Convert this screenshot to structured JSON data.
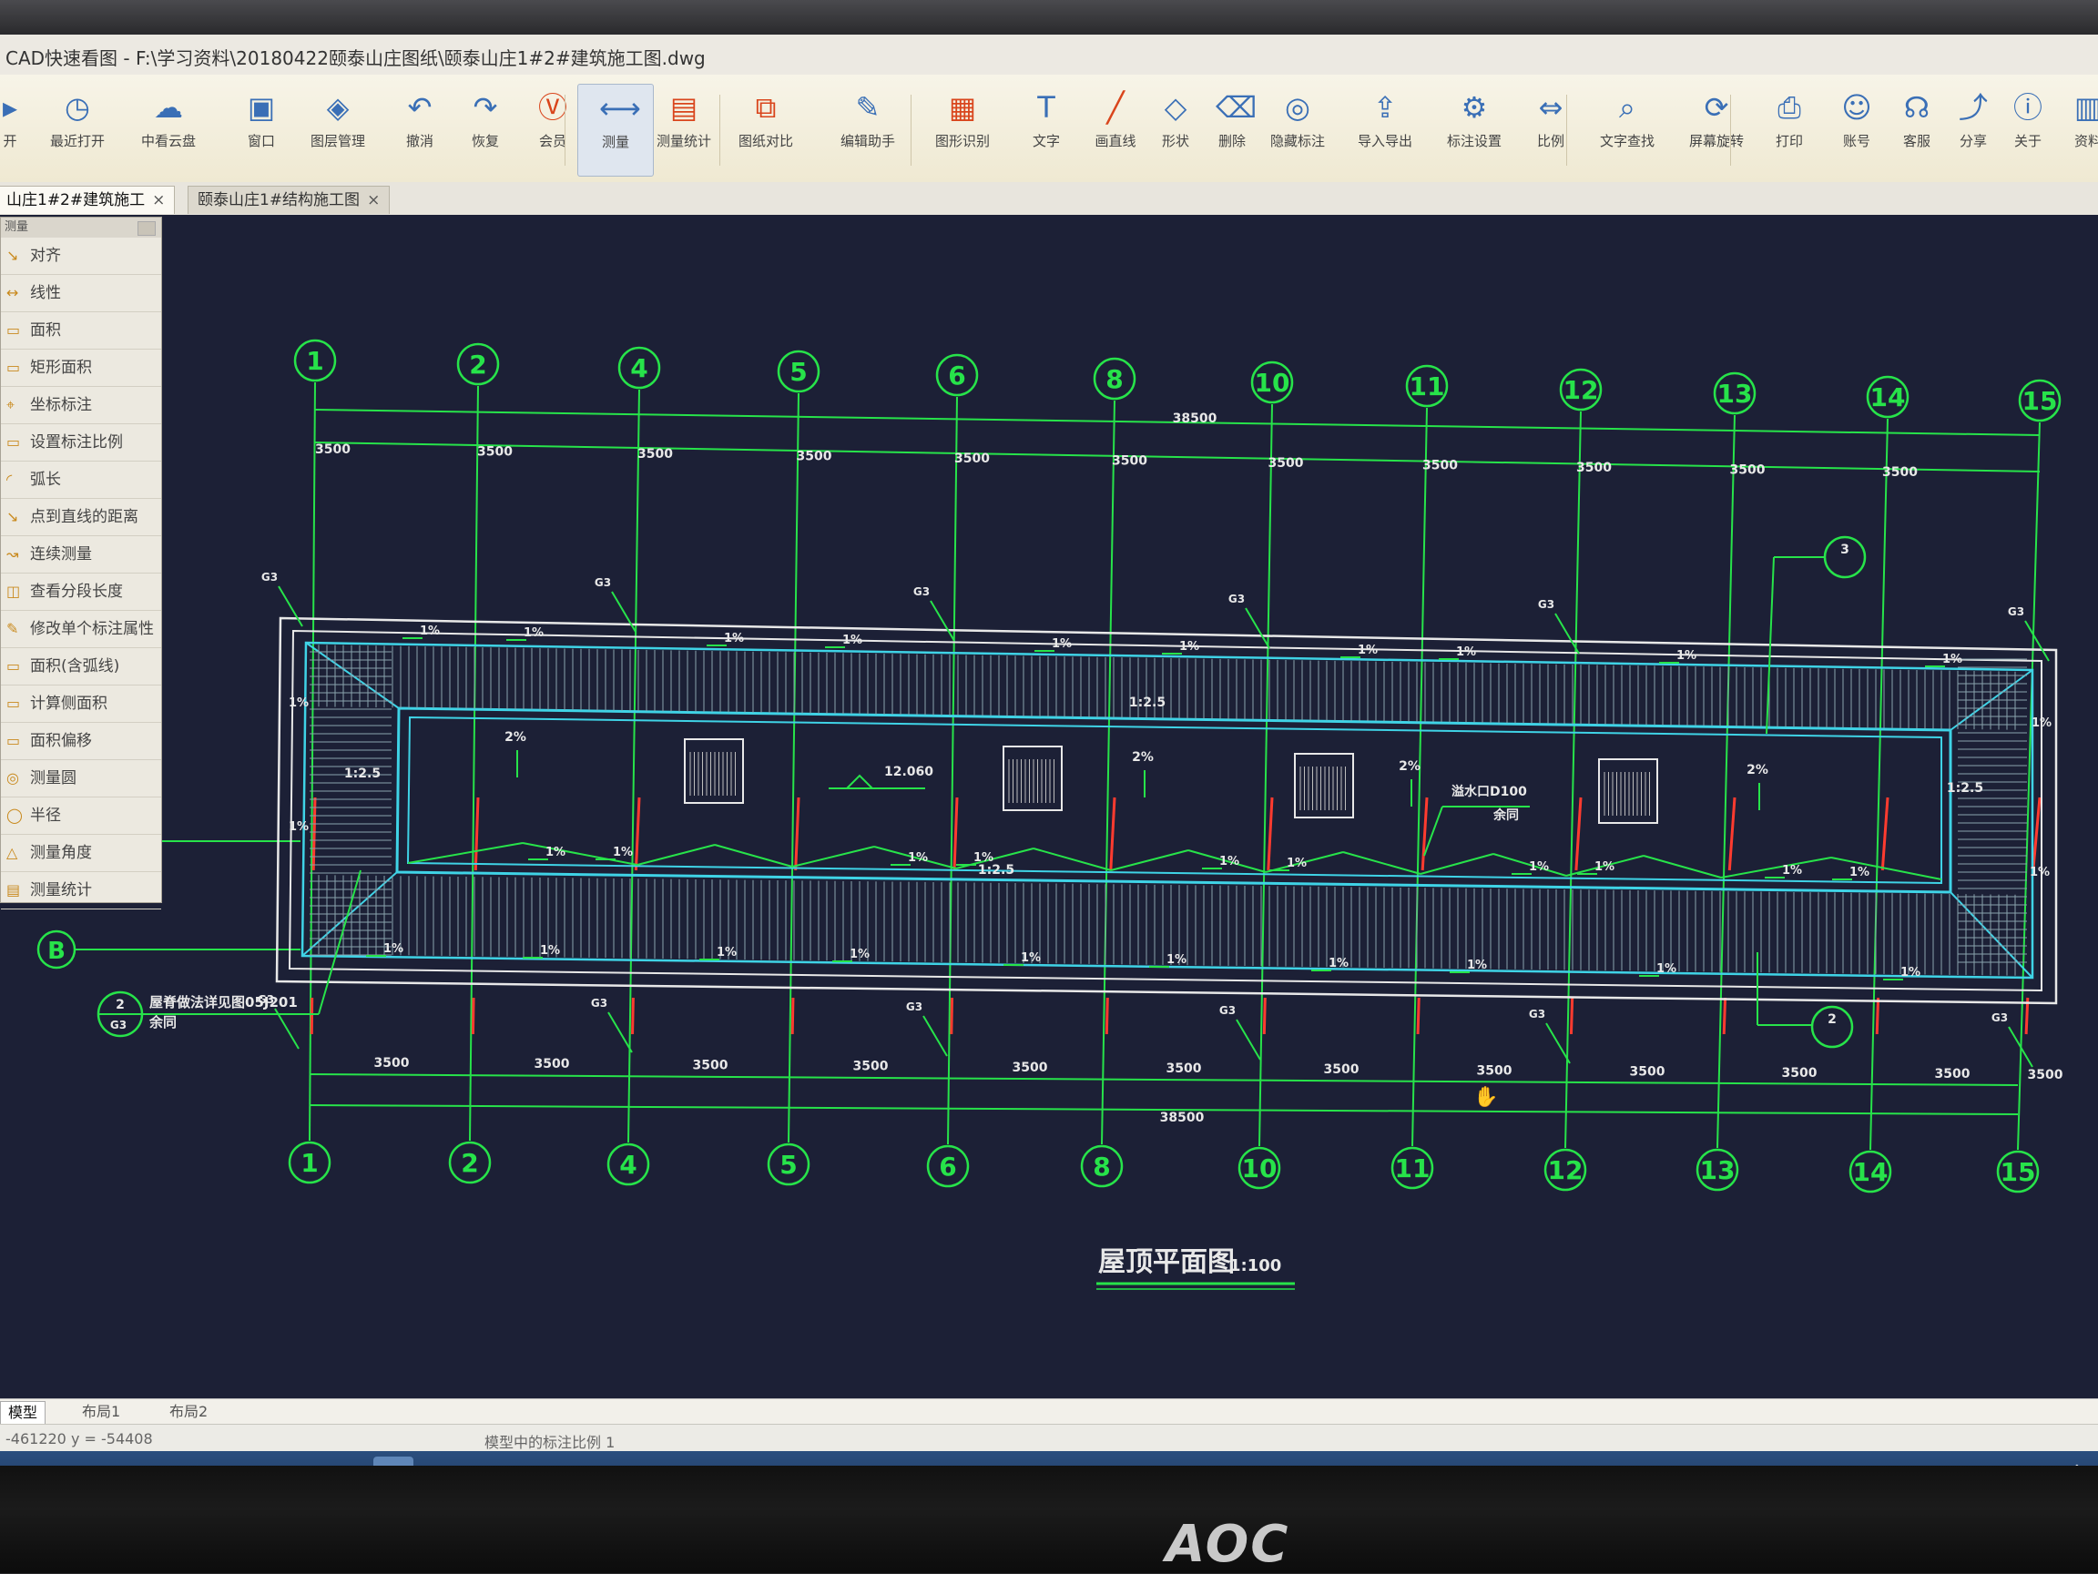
{
  "window": {
    "title": "CAD快速看图 - F:\\学习资料\\20180422颐泰山庄图纸\\颐泰山庄1#2#建筑施工图.dwg"
  },
  "toolbar": {
    "buttons": [
      {
        "label": "开",
        "icon": "open-icon"
      },
      {
        "label": "最近打开",
        "icon": "recent-icon"
      },
      {
        "label": "中看云盘",
        "icon": "cloud-icon"
      },
      {
        "label": "窗口",
        "icon": "window-icon"
      },
      {
        "label": "图层管理",
        "icon": "layers-icon"
      },
      {
        "label": "撤消",
        "icon": "undo-icon"
      },
      {
        "label": "恢复",
        "icon": "redo-icon"
      },
      {
        "label": "会员",
        "icon": "vip-icon"
      },
      {
        "label": "测量",
        "icon": "measure-icon"
      },
      {
        "label": "测量统计",
        "icon": "measure-stats-icon"
      },
      {
        "label": "图纸对比",
        "icon": "compare-icon"
      },
      {
        "label": "编辑助手",
        "icon": "edit-helper-icon"
      },
      {
        "label": "图形识别",
        "icon": "recognize-icon"
      },
      {
        "label": "文字",
        "icon": "text-icon"
      },
      {
        "label": "画直线",
        "icon": "line-icon"
      },
      {
        "label": "形状",
        "icon": "shape-icon"
      },
      {
        "label": "删除",
        "icon": "eraser-icon"
      },
      {
        "label": "隐藏标注",
        "icon": "hide-icon"
      },
      {
        "label": "导入导出",
        "icon": "import-export-icon"
      },
      {
        "label": "标注设置",
        "icon": "annotation-settings-icon"
      },
      {
        "label": "比例",
        "icon": "scale-icon"
      },
      {
        "label": "文字查找",
        "icon": "find-text-icon"
      },
      {
        "label": "屏幕旋转",
        "icon": "rotate-screen-icon"
      },
      {
        "label": "打印",
        "icon": "print-icon"
      },
      {
        "label": "账号",
        "icon": "account-icon"
      },
      {
        "label": "客服",
        "icon": "headset-icon"
      },
      {
        "label": "分享",
        "icon": "share-icon"
      },
      {
        "label": "关于",
        "icon": "info-icon"
      },
      {
        "label": "资料",
        "icon": "docs-icon"
      }
    ]
  },
  "tabs": [
    {
      "label": "山庄1#2#建筑施工",
      "close": "×"
    },
    {
      "label": "颐泰山庄1#结构施工图",
      "close": "×"
    }
  ],
  "measure_panel": {
    "header": "测量",
    "items": [
      "对齐",
      "线性",
      "面积",
      "矩形面积",
      "坐标标注",
      "设置标注比例",
      "弧长",
      "点到直线的距离",
      "连续测量",
      "查看分段长度",
      "修改单个标注属性",
      "面积(含弧线)",
      "计算侧面积",
      "面积偏移",
      "测量圆",
      "半径",
      "测量角度",
      "测量统计"
    ]
  },
  "drawing": {
    "title": "屋顶平面图",
    "scale": "1:100",
    "top_axes": [
      "1",
      "2",
      "4",
      "5",
      "6",
      "8",
      "10",
      "11",
      "12",
      "13",
      "14",
      "15"
    ],
    "bottom_axes": [
      "1",
      "2",
      "4",
      "5",
      "6",
      "8",
      "10",
      "11",
      "12",
      "13",
      "14",
      "15"
    ],
    "side_axis": "B",
    "total_dim": "38500",
    "bay_dim": "3500",
    "slope_1pct": "1%",
    "slope_2pct": "2%",
    "slope_ratio": "1:2.5",
    "elevation": "12.060",
    "drain": "G3",
    "callout_2": "2",
    "callout_3": "3",
    "callout_ref": "G3",
    "note_line1": "屋脊做法详见图05J201",
    "note_line2": "余同",
    "drain_note1": "溢水口D100",
    "drain_note2": "余同"
  },
  "layout_tabs": [
    "模型",
    "布局1",
    "布局2"
  ],
  "status": {
    "coords": "-461220  y = -54408",
    "message": "模型中的标注比例 1"
  },
  "monitor_brand": "AOC",
  "colors": {
    "axis": "#27e34a",
    "cyan": "#3fd3e6",
    "red": "#ff3b2f",
    "white": "#e8e8e8"
  }
}
